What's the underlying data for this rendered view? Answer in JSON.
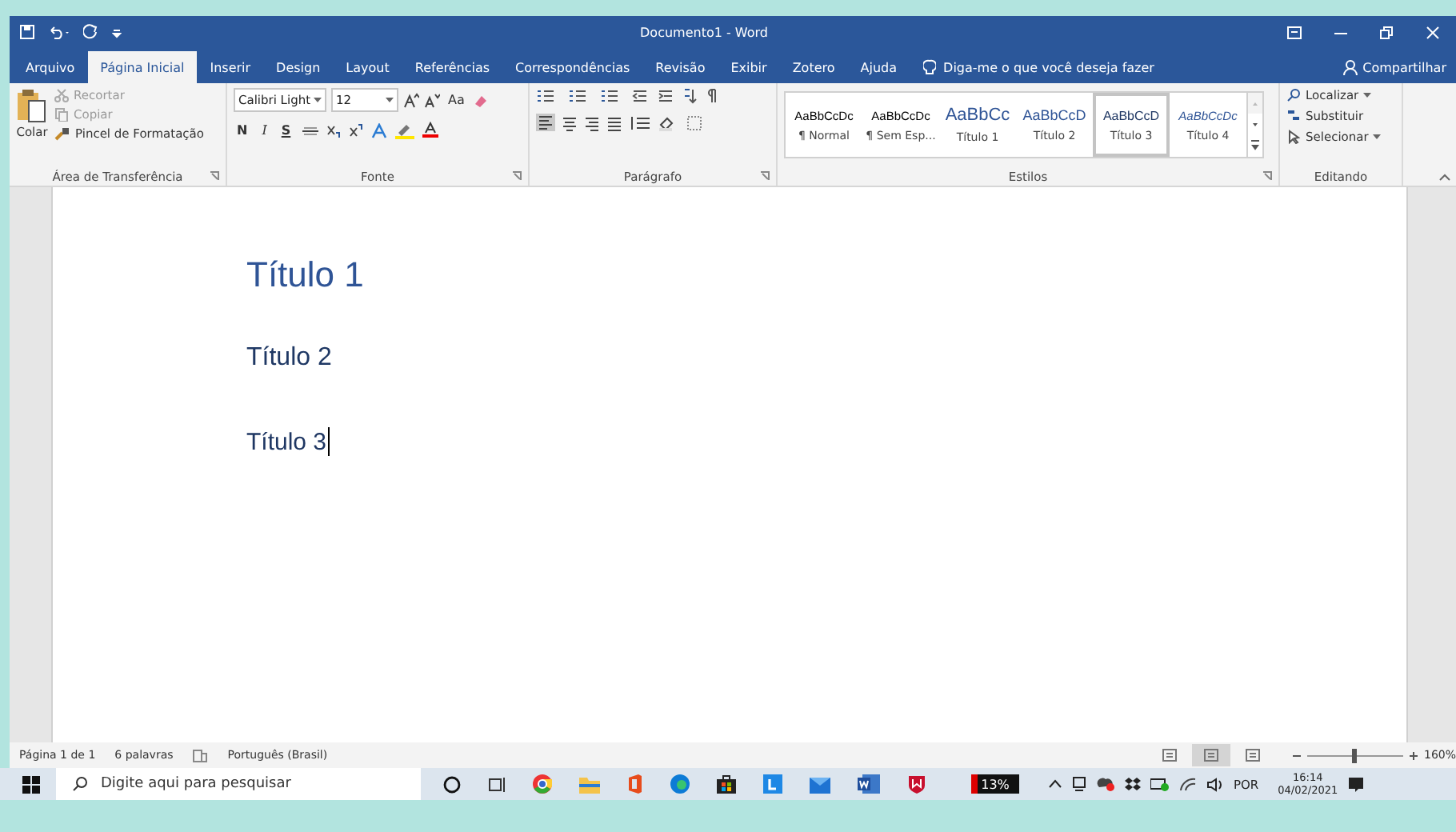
{
  "window": {
    "title": "Documento1 - Word"
  },
  "tabs": [
    {
      "label": "Arquivo",
      "selected": false
    },
    {
      "label": "Página Inicial",
      "selected": true
    },
    {
      "label": "Inserir",
      "selected": false
    },
    {
      "label": "Design",
      "selected": false
    },
    {
      "label": "Layout",
      "selected": false
    },
    {
      "label": "Referências",
      "selected": false
    },
    {
      "label": "Correspondências",
      "selected": false
    },
    {
      "label": "Revisão",
      "selected": false
    },
    {
      "label": "Exibir",
      "selected": false
    },
    {
      "label": "Zotero",
      "selected": false
    },
    {
      "label": "Ajuda",
      "selected": false
    }
  ],
  "tell_me": {
    "placeholder": "Diga-me o que você deseja fazer"
  },
  "share": "Compartilhar",
  "clipboard": {
    "paste": "Colar",
    "cut": "Recortar",
    "copy": "Copiar",
    "format_painter": "Pincel de Formatação",
    "label": "Área de Transferência"
  },
  "font": {
    "name": "Calibri Light",
    "size": "12",
    "case": "Aa",
    "bold": "N",
    "italic": "I",
    "underline": "S",
    "label": "Fonte"
  },
  "paragraph": {
    "label": "Parágrafo"
  },
  "styles": {
    "label": "Estilos",
    "items": [
      {
        "preview": "AaBbCcDc",
        "name": "¶ Normal",
        "kind": "normal",
        "selected": false
      },
      {
        "preview": "AaBbCcDc",
        "name": "¶ Sem Esp...",
        "kind": "normal",
        "selected": false
      },
      {
        "preview": "AaBbCc",
        "name": "Título 1",
        "kind": "h1",
        "selected": false
      },
      {
        "preview": "AaBbCcD",
        "name": "Título 2",
        "kind": "h2",
        "selected": false
      },
      {
        "preview": "AaBbCcD",
        "name": "Título 3",
        "kind": "h3",
        "selected": true
      },
      {
        "preview": "AaBbCcDc",
        "name": "Título 4",
        "kind": "h4",
        "selected": false
      }
    ]
  },
  "editing": {
    "find": "Localizar",
    "replace": "Substituir",
    "select": "Selecionar",
    "label": "Editando"
  },
  "document": {
    "paragraphs": [
      {
        "kind": "h1",
        "text": "Título 1"
      },
      {
        "kind": "h2",
        "text": "Título 2"
      },
      {
        "kind": "h3",
        "text": "Título 3"
      }
    ]
  },
  "status_bar": {
    "page": "Página 1 de 1",
    "words": "6 palavras",
    "language": "Português (Brasil)",
    "views": [
      {
        "selected": false
      },
      {
        "selected": true
      },
      {
        "selected": false
      }
    ],
    "zoom": {
      "level": 0.5,
      "reading": "160%"
    }
  },
  "taskbar": {
    "search": {
      "placeholder": "Digite aqui para pesquisar"
    },
    "battery": {
      "level": 0.13,
      "reading": "13%"
    },
    "language": "POR",
    "time": "16:14",
    "date": "04/02/2021"
  }
}
